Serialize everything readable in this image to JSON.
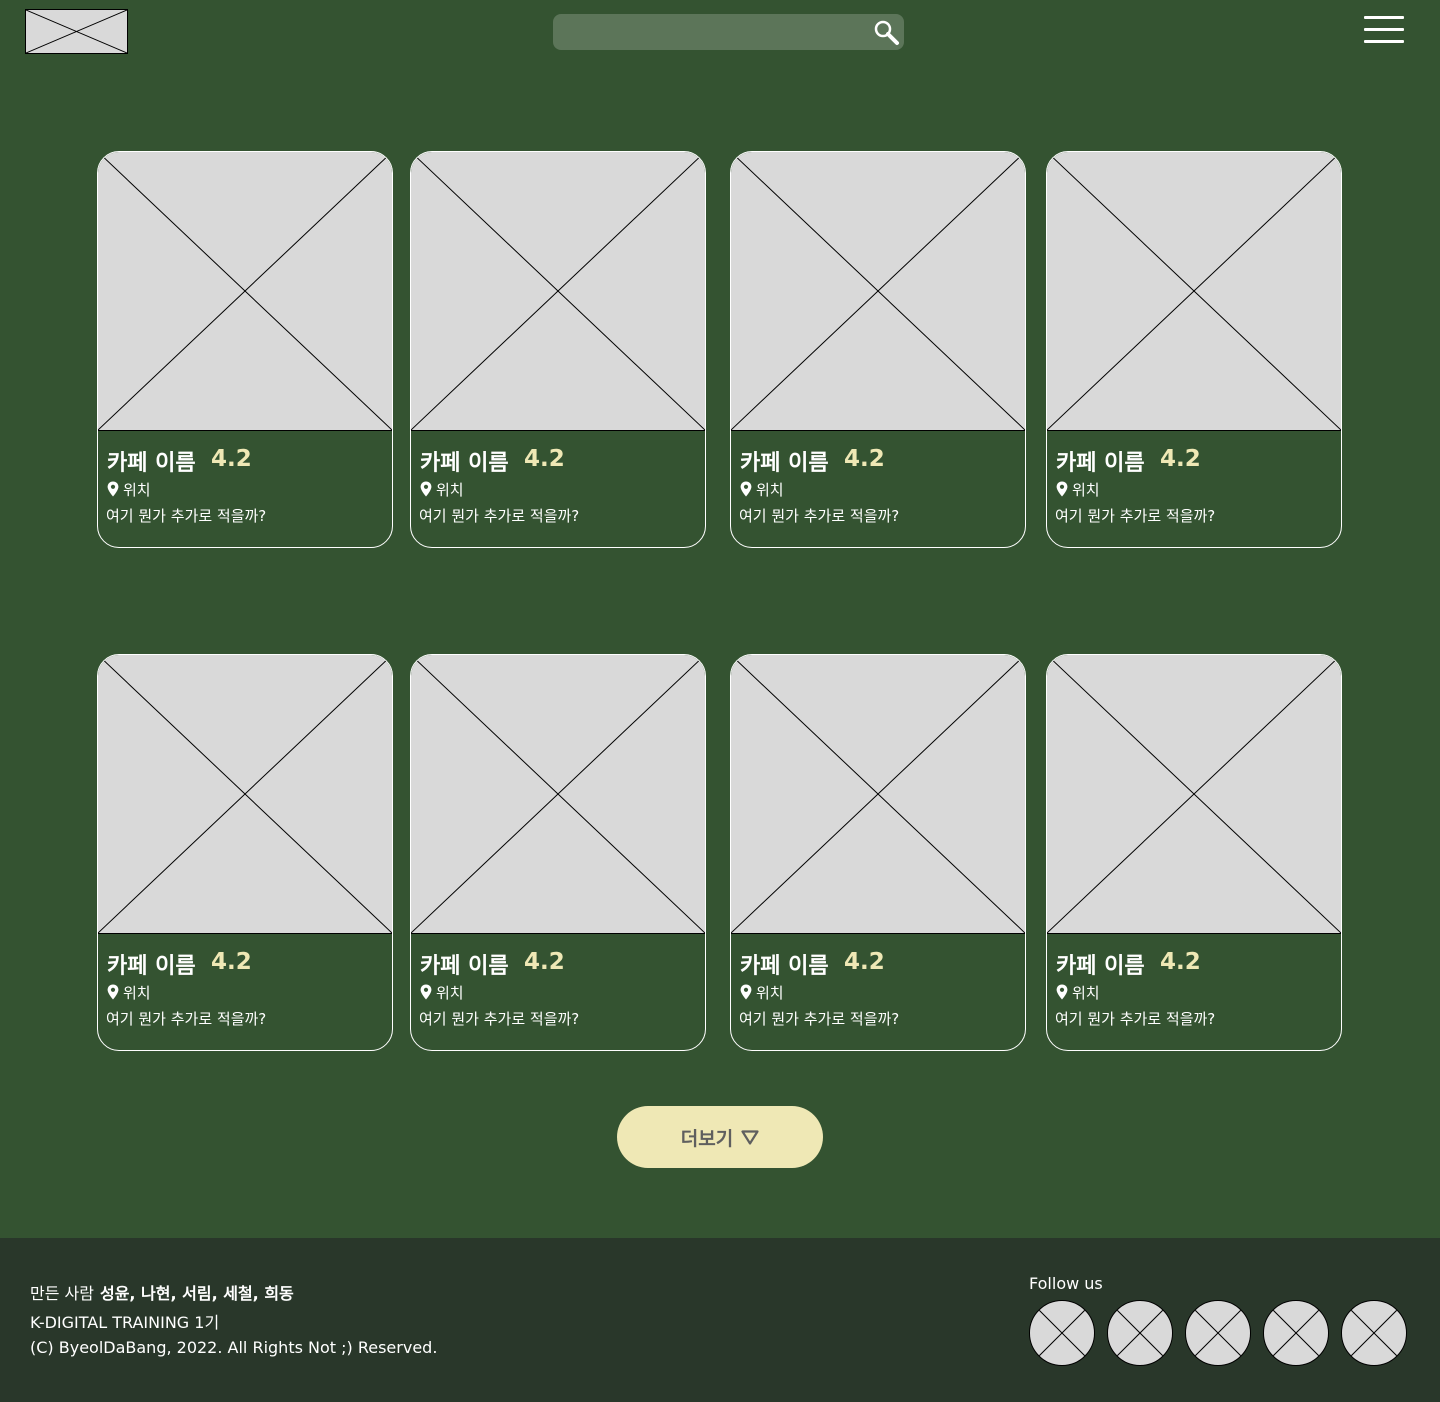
{
  "header": {
    "logo_alt": "logo",
    "search": {
      "placeholder": "",
      "value": ""
    },
    "icons": {
      "search": "search-icon",
      "menu": "hamburger-menu-icon"
    }
  },
  "cards": [
    {
      "name": "카페 이름",
      "rating": "4.2",
      "location": "위치",
      "description": "여기 뭔가 추가로 적을까?"
    },
    {
      "name": "카페 이름",
      "rating": "4.2",
      "location": "위치",
      "description": "여기 뭔가 추가로 적을까?"
    },
    {
      "name": "카페 이름",
      "rating": "4.2",
      "location": "위치",
      "description": "여기 뭔가 추가로 적을까?"
    },
    {
      "name": "카페 이름",
      "rating": "4.2",
      "location": "위치",
      "description": "여기 뭔가 추가로 적을까?"
    },
    {
      "name": "카페 이름",
      "rating": "4.2",
      "location": "위치",
      "description": "여기 뭔가 추가로 적을까?"
    },
    {
      "name": "카페 이름",
      "rating": "4.2",
      "location": "위치",
      "description": "여기 뭔가 추가로 적을까?"
    },
    {
      "name": "카페 이름",
      "rating": "4.2",
      "location": "위치",
      "description": "여기 뭔가 추가로 적을까?"
    },
    {
      "name": "카페 이름",
      "rating": "4.2",
      "location": "위치",
      "description": "여기 뭔가 추가로 적을까?"
    }
  ],
  "more_button": {
    "label": "더보기",
    "icon": "triangle-down-icon"
  },
  "footer": {
    "makers_label": "만든 사람",
    "makers": "성윤, 나현, 서림, 세철, 희동",
    "program": "K-DIGITAL TRAINING 1기",
    "copyright": "(C) ByeolDaBang, 2022. All Rights Not ;) Reserved.",
    "follow_label": "Follow us",
    "social_count": 5
  },
  "colors": {
    "background": "#345331",
    "footer": "#29372a",
    "search_bg": "#5c7559",
    "placeholder": "#d9d9d9",
    "accent": "#efe8b5",
    "button_text": "#5f5f5f"
  }
}
